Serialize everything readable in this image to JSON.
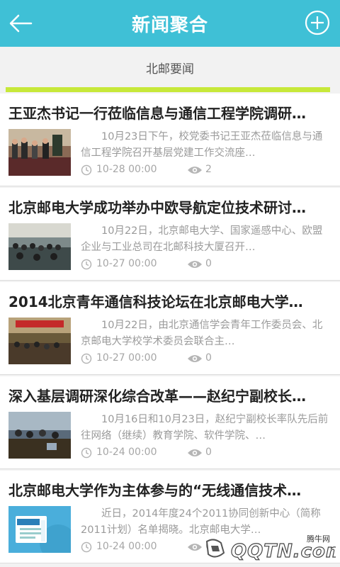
{
  "header": {
    "title": "新闻聚合",
    "back_icon": "arrow-left-icon",
    "add_icon": "plus-circle-icon",
    "bg_color": "#3fc0d6"
  },
  "tabs": [
    {
      "label": "北邮要闻",
      "selected": true
    }
  ],
  "indicator_color": "#c7e83a",
  "news": [
    {
      "title": "王亚杰书记一行莅临信息与通信工程学院调研…",
      "summary": "10月23日下午，校党委书记王亚杰莅临信息与通信工程学院召开基层党建工作交流座…",
      "date": "10-28 00:00",
      "views": "2"
    },
    {
      "title": "北京邮电大学成功举办中欧导航定位技术研讨…",
      "summary": "10月22日，北京邮电大学、国家遥感中心、欧盟企业与工业总司在北邮科技大厦召开…",
      "date": "10-27 00:00",
      "views": "0"
    },
    {
      "title": "2014北京青年通信科技论坛在北京邮电大学…",
      "summary": "10月22日，由北京通信学会青年工作委员会、北京邮电大学校学术委员会联合主…",
      "date": "10-27 00:00",
      "views": "0"
    },
    {
      "title": "深入基层调研深化综合改革——赵纪宁副校长…",
      "summary": "10月16日和10月23日，赵纪宁副校长率队先后前往网络（继续）教育学院、软件学院、…",
      "date": "10-24 00:00",
      "views": "0"
    },
    {
      "title": "北京邮电大学作为主体参与的“无线通信技术…",
      "summary": "近日，2014年度24个2011协同创新中心（简称2011计划）名单揭晓。北京邮电大学…",
      "date": "10-24 00:00",
      "views": "0"
    }
  ],
  "watermark": {
    "small_text": "腾牛网",
    "large_text": "QQTN.com"
  }
}
